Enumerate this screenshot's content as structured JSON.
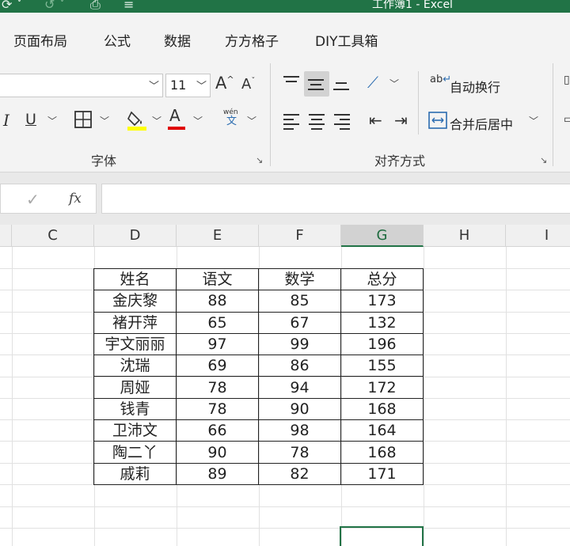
{
  "titlebar": {
    "title": "工作簿1 - Excel",
    "bg_color": "#217346"
  },
  "menu": {
    "tabs": [
      "页面布局",
      "公式",
      "数据",
      "方方格子",
      "DIY工具箱"
    ]
  },
  "ribbon": {
    "font_size": "11",
    "grow_font": "A",
    "shrink_font": "A",
    "italic": "I",
    "underline": "U",
    "font_color_letter": "A",
    "phonetic_top": "wén",
    "phonetic_bottom": "文",
    "wrap_icon_top": "ab",
    "wrap_text_label": "自动换行",
    "merge_label": "合并后居中",
    "groups": {
      "font": "字体",
      "alignment": "对齐方式"
    },
    "accent_colors": {
      "highlight": "#ffff00",
      "font_color": "#e00000"
    }
  },
  "formula_bar": {
    "check": "✓",
    "fx": "fx"
  },
  "sheet": {
    "columns": [
      "C",
      "D",
      "E",
      "F",
      "G",
      "H",
      "I"
    ],
    "selected_column": "G",
    "table": {
      "headers": [
        "姓名",
        "语文",
        "数学",
        "总分"
      ],
      "rows": [
        [
          "金庆黎",
          "88",
          "85",
          "173"
        ],
        [
          "褚开萍",
          "65",
          "67",
          "132"
        ],
        [
          "宇文丽丽",
          "97",
          "99",
          "196"
        ],
        [
          "沈瑞",
          "69",
          "86",
          "155"
        ],
        [
          "周娅",
          "78",
          "94",
          "172"
        ],
        [
          "钱青",
          "78",
          "90",
          "168"
        ],
        [
          "卫沛文",
          "66",
          "98",
          "164"
        ],
        [
          "陶二丫",
          "90",
          "78",
          "168"
        ],
        [
          "戚莉",
          "89",
          "82",
          "171"
        ]
      ]
    }
  }
}
